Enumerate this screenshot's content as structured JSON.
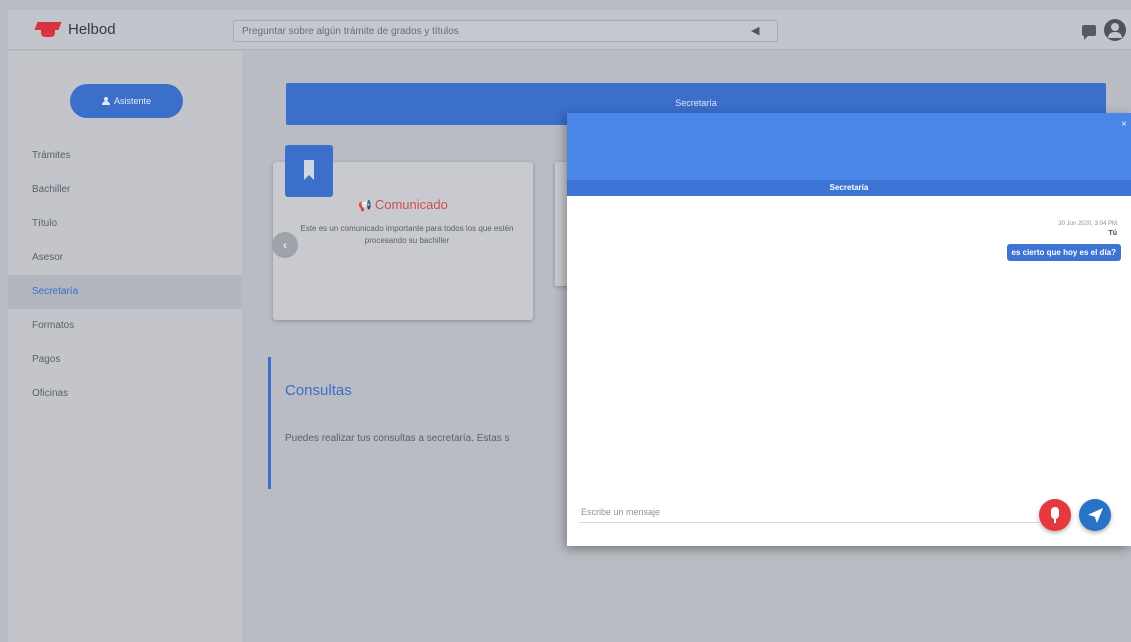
{
  "header": {
    "app_name": "Helbod",
    "search_placeholder": "Preguntar sobre algún trámite de grados y títulos",
    "send_icon": "send-icon",
    "icons": [
      "message-icon",
      "user-icon"
    ]
  },
  "sidebar": {
    "account_label": "Asistente",
    "items": [
      {
        "label": "Trámites"
      },
      {
        "label": "Bachiller"
      },
      {
        "label": "Título"
      },
      {
        "label": "Asesor"
      },
      {
        "label": "Secretaría"
      },
      {
        "label": "Formatos"
      },
      {
        "label": "Pagos"
      },
      {
        "label": "Oficinas"
      }
    ],
    "active_item": "Secretaría"
  },
  "main": {
    "banner_title": "Secretaría",
    "card": {
      "title": "Comunicado",
      "text": "Este es un comunicado importante para todos los que estén procesando su bachiller",
      "prev_label": "‹"
    },
    "consultas": {
      "title": "Consultas",
      "text": "Puedes realizar tus consultas a secretaría. Estas s"
    }
  },
  "chat": {
    "close_label": "×",
    "title": "Secretaría",
    "message": {
      "timestamp": "30 Jun 2020, 3:04 PM",
      "author": "Tú",
      "text": "es cierto que hoy es el día?"
    },
    "input_placeholder": "Escribe un mensaje"
  },
  "colors": {
    "primary": "#3b6fca",
    "chat_header": "#4a86e8",
    "mic": "#e53940",
    "alert": "#cf4f4f"
  }
}
